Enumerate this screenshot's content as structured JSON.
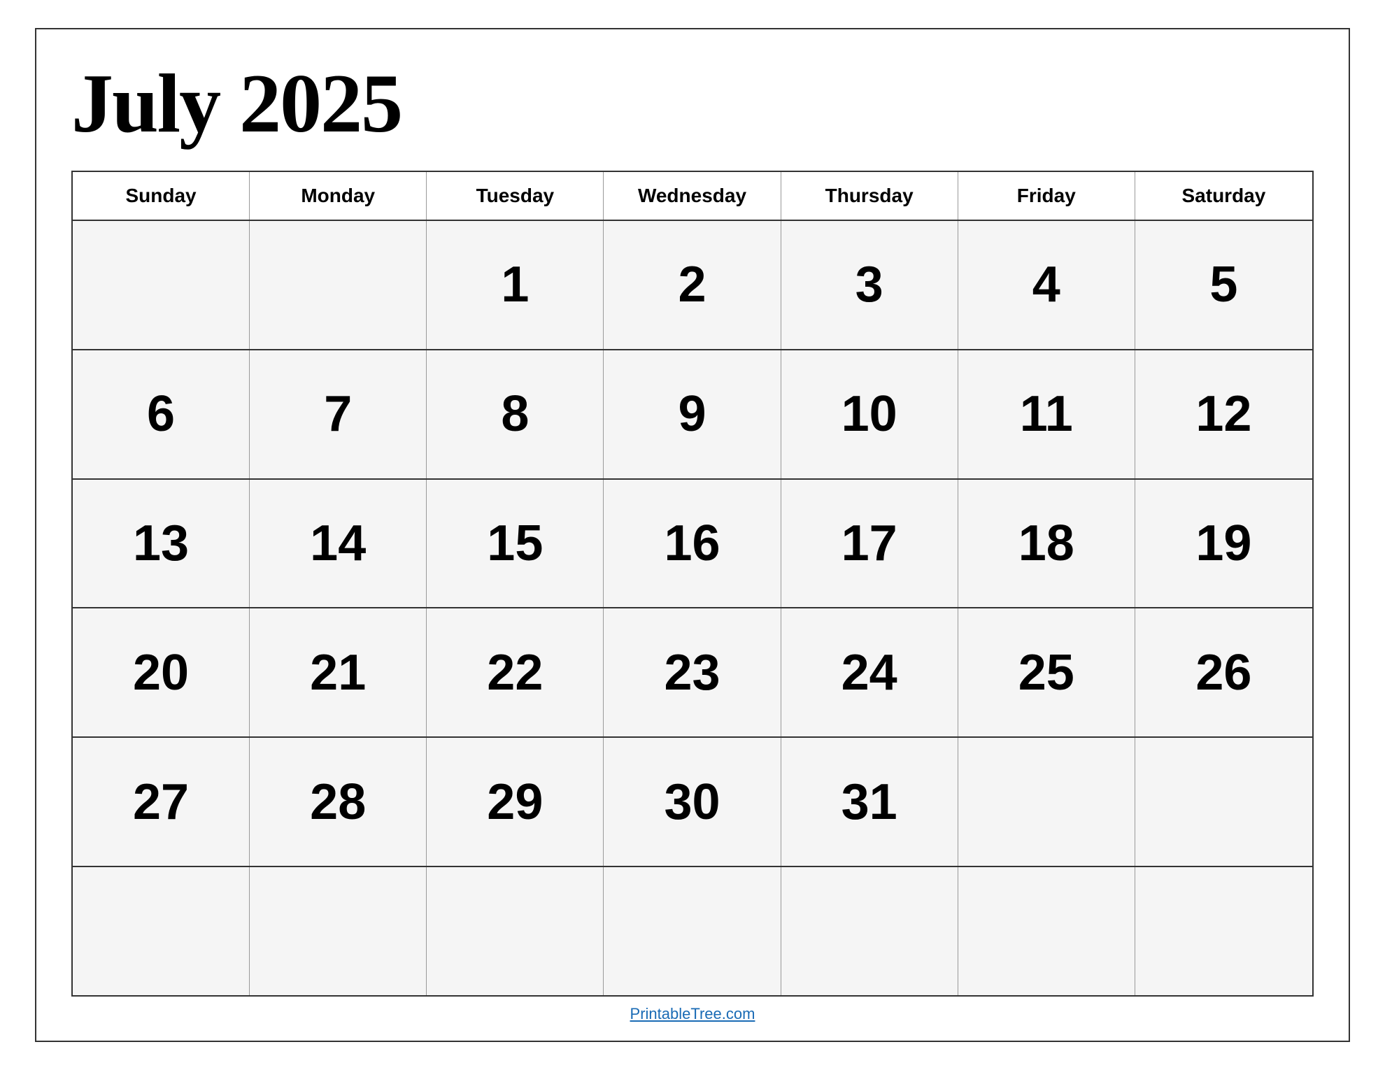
{
  "title": "July 2025",
  "days_of_week": [
    "Sunday",
    "Monday",
    "Tuesday",
    "Wednesday",
    "Thursday",
    "Friday",
    "Saturday"
  ],
  "weeks": [
    [
      "",
      "",
      "1",
      "2",
      "3",
      "4",
      "5"
    ],
    [
      "6",
      "7",
      "8",
      "9",
      "10",
      "11",
      "12"
    ],
    [
      "13",
      "14",
      "15",
      "16",
      "17",
      "18",
      "19"
    ],
    [
      "20",
      "21",
      "22",
      "23",
      "24",
      "25",
      "26"
    ],
    [
      "27",
      "28",
      "29",
      "30",
      "31",
      "",
      ""
    ],
    [
      "",
      "",
      "",
      "",
      "",
      "",
      ""
    ]
  ],
  "footer_link": "PrintableTree.com",
  "footer_url": "PrintableTree.com"
}
